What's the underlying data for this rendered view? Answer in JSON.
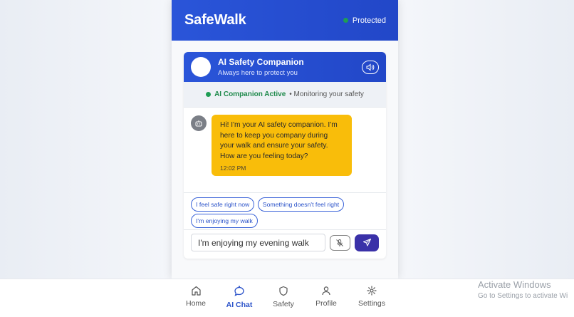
{
  "header": {
    "title": "SafeWalk",
    "status": "Protected"
  },
  "companion": {
    "title": "AI Safety Companion",
    "subtitle": "Always here to protect you",
    "active_label": "AI Companion Active",
    "active_sub": "• Monitoring your safety"
  },
  "chat": {
    "message": "Hi! I'm your AI safety companion. I'm here to keep you company during your walk and ensure your safety. How are you feeling today?",
    "time": "12:02 PM"
  },
  "quick_replies": [
    "I feel safe right now",
    "Something doesn't feel right",
    "I'm enjoying my walk"
  ],
  "input": {
    "value": "I'm enjoying my evening walk"
  },
  "nav": {
    "home": "Home",
    "ai_chat": "AI Chat",
    "safety": "Safety",
    "profile": "Profile",
    "settings": "Settings"
  },
  "watermark": {
    "title": "Activate Windows",
    "subtitle": "Go to Settings to activate Wi"
  },
  "colors": {
    "primary": "#2a55d9",
    "accent": "#f9bd0a",
    "success": "#1f9d55",
    "send": "#3a31a8"
  }
}
